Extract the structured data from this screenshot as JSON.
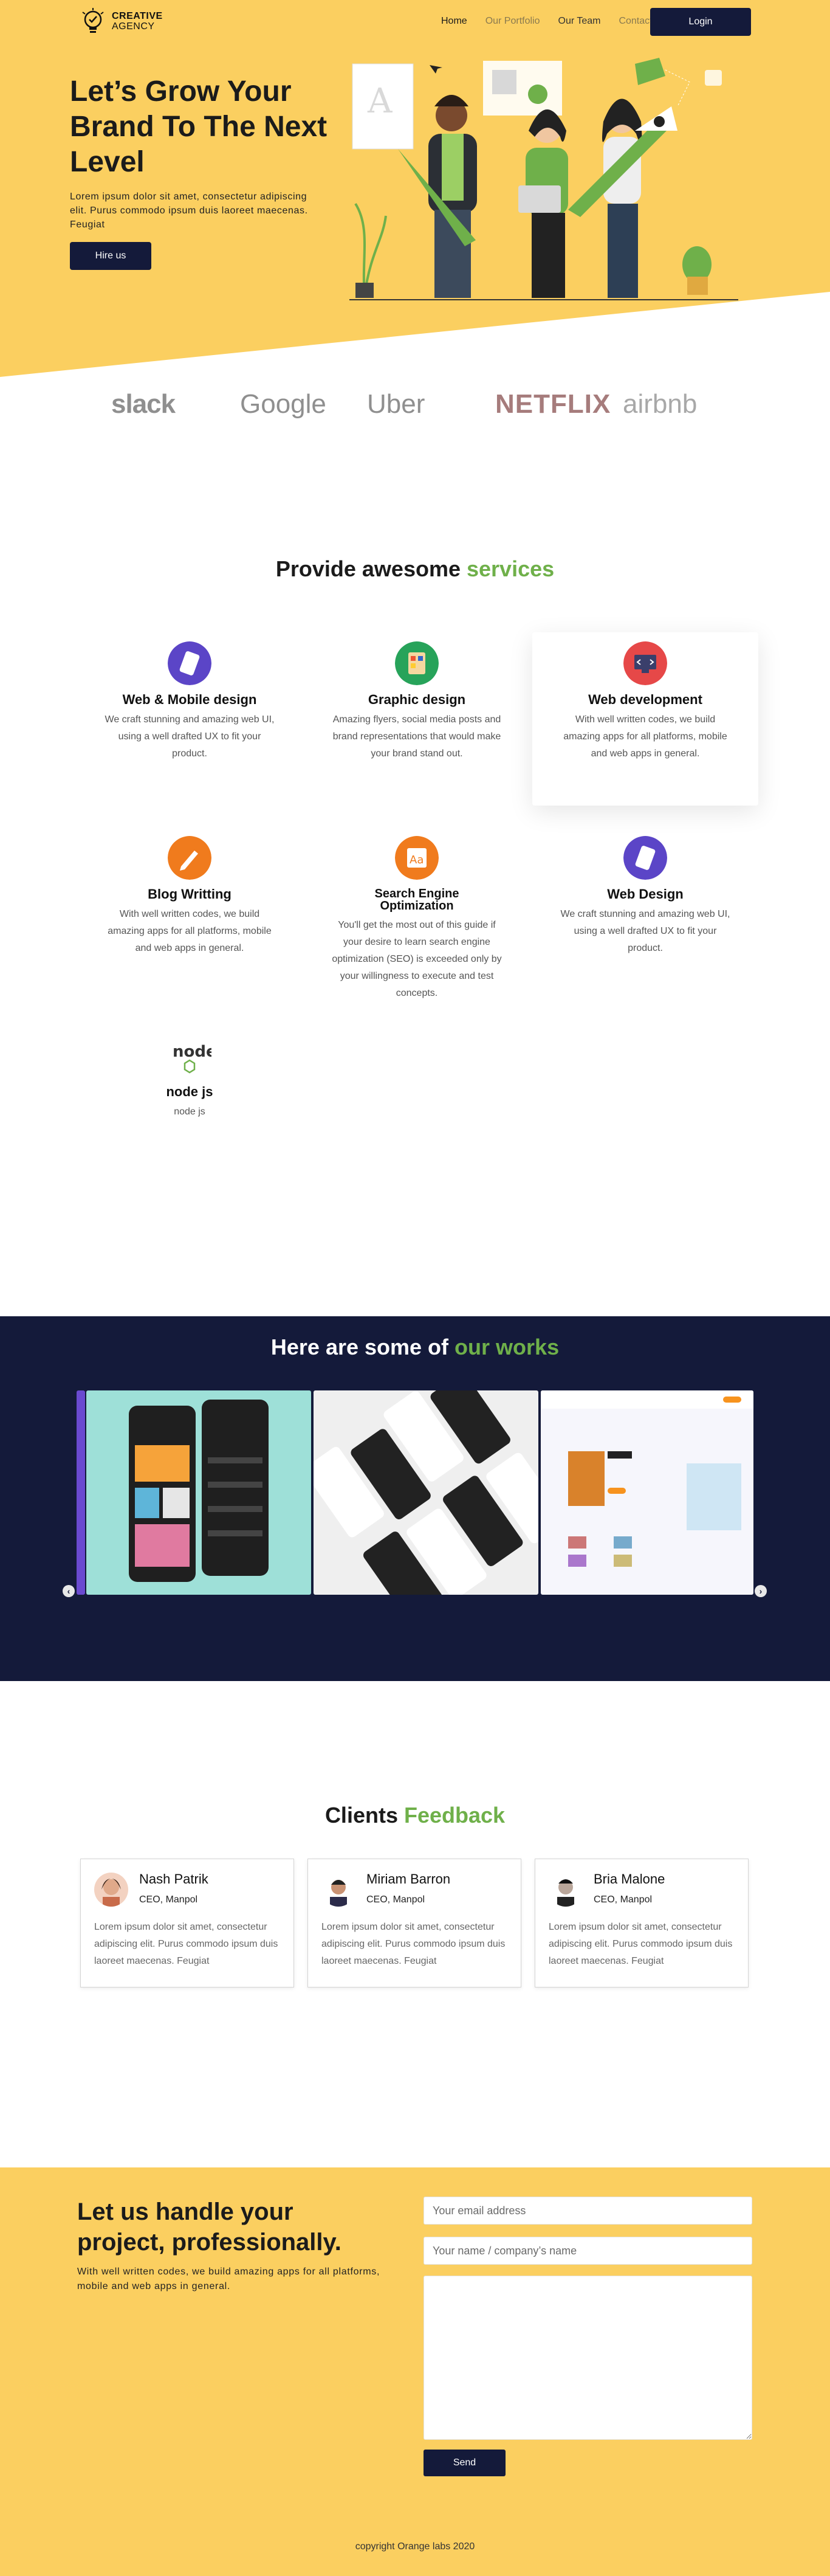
{
  "nav": {
    "logo_line1": "CREATIVE",
    "logo_line2": "AGENCY",
    "links": [
      {
        "label": "Home"
      },
      {
        "label": "Our Portfolio"
      },
      {
        "label": "Our Team"
      },
      {
        "label": "Contact"
      }
    ],
    "login_label": "Login"
  },
  "hero": {
    "title": "Let’s Grow Your Brand To The Next Level",
    "text": "Lorem ipsum dolor sit amet, consectetur adipiscing elit. Purus commodo ipsum duis laoreet maecenas. Feugiat",
    "cta_label": "Hire us"
  },
  "brands": [
    "slack",
    "Google",
    "Uber",
    "NETFLIX",
    "airbnb"
  ],
  "services": {
    "title_prefix": "Provide awesome ",
    "title_highlight": "services",
    "items": [
      {
        "name": "Web & Mobile design",
        "desc": "We craft stunning and amazing web UI, using a well drafted UX to fit your product.",
        "icon": "mobile-design-icon"
      },
      {
        "name": "Graphic design",
        "desc": "Amazing flyers, social media posts and brand representations that would make your brand stand out.",
        "icon": "color-palette-icon"
      },
      {
        "name": "Web development",
        "desc": "With well written codes, we build amazing apps for all platforms, mobile and web apps in general.",
        "icon": "code-monitor-icon"
      },
      {
        "name": "Blog Writting",
        "desc": "With well written codes, we build amazing apps for all platforms, mobile and web apps in general.",
        "icon": "pen-writing-icon"
      },
      {
        "name": "Search Engine Optimization",
        "desc": "You'll get the most out of this guide if your desire to learn search engine optimization (SEO) is exceeded only by your willingness to execute and test concepts.",
        "icon": "font-aa-icon"
      },
      {
        "name": "Web Design",
        "desc": "We craft stunning and amazing web UI, using a well drafted UX to fit your product.",
        "icon": "mobile-design-icon"
      },
      {
        "name": "node js",
        "desc": "node js",
        "icon": "nodejs-logo-icon"
      }
    ]
  },
  "works": {
    "title_prefix": "Here are some of ",
    "title_highlight": "our works",
    "prev": "‹",
    "next": "›"
  },
  "feedback": {
    "title_prefix": "Clients ",
    "title_highlight": "Feedback",
    "items": [
      {
        "name": "Nash Patrik",
        "role": "CEO, Manpol",
        "text": "Lorem ipsum dolor sit amet, consectetur adipiscing elit. Purus commodo ipsum duis laoreet maecenas. Feugiat"
      },
      {
        "name": "Miriam Barron",
        "role": "CEO, Manpol",
        "text": "Lorem ipsum dolor sit amet, consectetur adipiscing elit. Purus commodo ipsum duis laoreet maecenas. Feugiat"
      },
      {
        "name": "Bria Malone",
        "role": "CEO, Manpol",
        "text": "Lorem ipsum dolor sit amet, consectetur adipiscing elit. Purus commodo ipsum duis laoreet maecenas. Feugiat"
      }
    ]
  },
  "contact": {
    "title": "Let us handle your project, professionally.",
    "text": "With well written codes, we build amazing apps for all platforms, mobile and web apps in general.",
    "email_placeholder": "Your email address",
    "name_placeholder": "Your name / company’s name",
    "send_label": "Send"
  },
  "footer": {
    "copyright": "copyright Orange labs 2020"
  },
  "colors": {
    "accent_yellow": "#fbcf60",
    "navy": "#141a3a",
    "green_highlight": "#6fb04a"
  }
}
